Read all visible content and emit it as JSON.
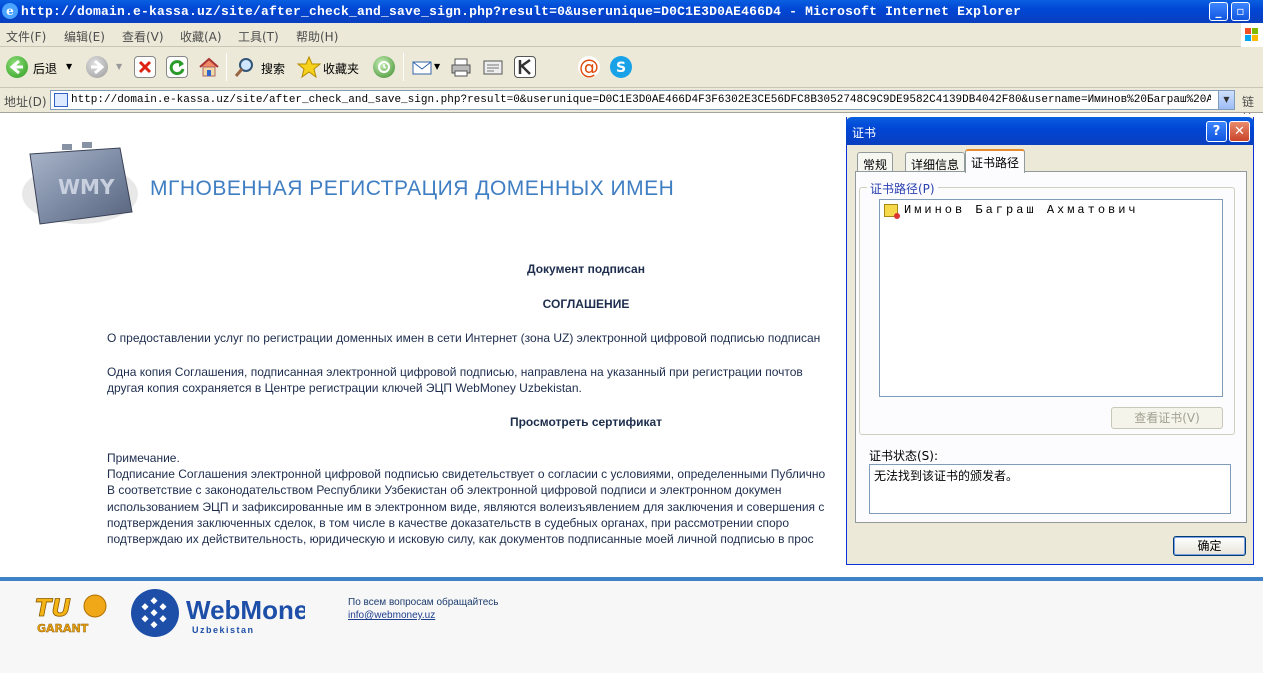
{
  "window": {
    "title": "http://domain.e-kassa.uz/site/after_check_and_save_sign.php?result=0&userunique=D0C1E3D0AE466D4 - Microsoft Internet Explorer"
  },
  "menu": [
    "文件(F)",
    "编辑(E)",
    "查看(V)",
    "收藏(A)",
    "工具(T)",
    "帮助(H)"
  ],
  "toolbar": {
    "back_label": "后退",
    "search_label": "搜索",
    "favorites_label": "收藏夹"
  },
  "address": {
    "label": "地址(D)",
    "url": "http://domain.e-kassa.uz/site/after_check_and_save_sign.php?result=0&userunique=D0C1E3D0AE466D4F3F6302E3CE56DFC8B3052748C9C9DE9582C4139DB4042F80&username=Иминов%20Баграш%20Ахма",
    "links_label": "链接"
  },
  "page": {
    "logo_text": "WMY",
    "site_title": "МГНОВЕННАЯ РЕГИСТРАЦИЯ ДОМЕННЫХ ИМЕН",
    "doc_signed": "Документ подписан",
    "agreement_heading": "СОГЛАШЕНИЕ",
    "para1": "О предоставлении услуг по регистрации доменных имен в сети Интернет (зона UZ) электронной цифровой подписью подписан",
    "para2_line1": "Одна копия Соглашения, подписанная электронной цифровой подписью, направлена на указанный при регистрации почтов",
    "para2_line2": "другая копия сохраняется в Центре регистрации ключей ЭЦП WebMoney Uzbekistan.",
    "view_cert": "Просмотреть сертификат",
    "note_lines": [
      "Примечание.",
      "Подписание Соглашения электронной цифровой подписью свидетельствует о согласии с условиями, определенными Публично",
      "В соответствие с законодательством Республики Узбекистан об электронной цифровой подписи и электронном докумен",
      "использованием ЭЦП и зафиксированные им в электронном виде, являются волеизъявлением для заключения и совершения с",
      "подтверждения заключенных сделок, в том числе в качестве доказательств в судебных органах, при рассмотрении споро",
      "подтверждаю их действительность, юридическую и исковую силу, как документов подписанные моей личной подписью в прос"
    ],
    "footer": {
      "tu_logo_top": "TU",
      "tu_logo_bottom": "GARANT",
      "webmoney": "WebMoney",
      "webmoney_sub": "Uzbekistan",
      "contact_line": "По всем вопросам обращайтесь",
      "contact_email": "info@webmoney.uz"
    }
  },
  "dialog": {
    "title": "证书",
    "tabs": [
      "常规",
      "详细信息",
      "证书路径"
    ],
    "path_label": "证书路径(P)",
    "path_items": [
      "Иминов Баграш Ахматович"
    ],
    "view_button": "查看证书(V)",
    "status_label": "证书状态(S):",
    "status_text": "无法找到该证书的颁发者。",
    "ok_button": "确定"
  }
}
